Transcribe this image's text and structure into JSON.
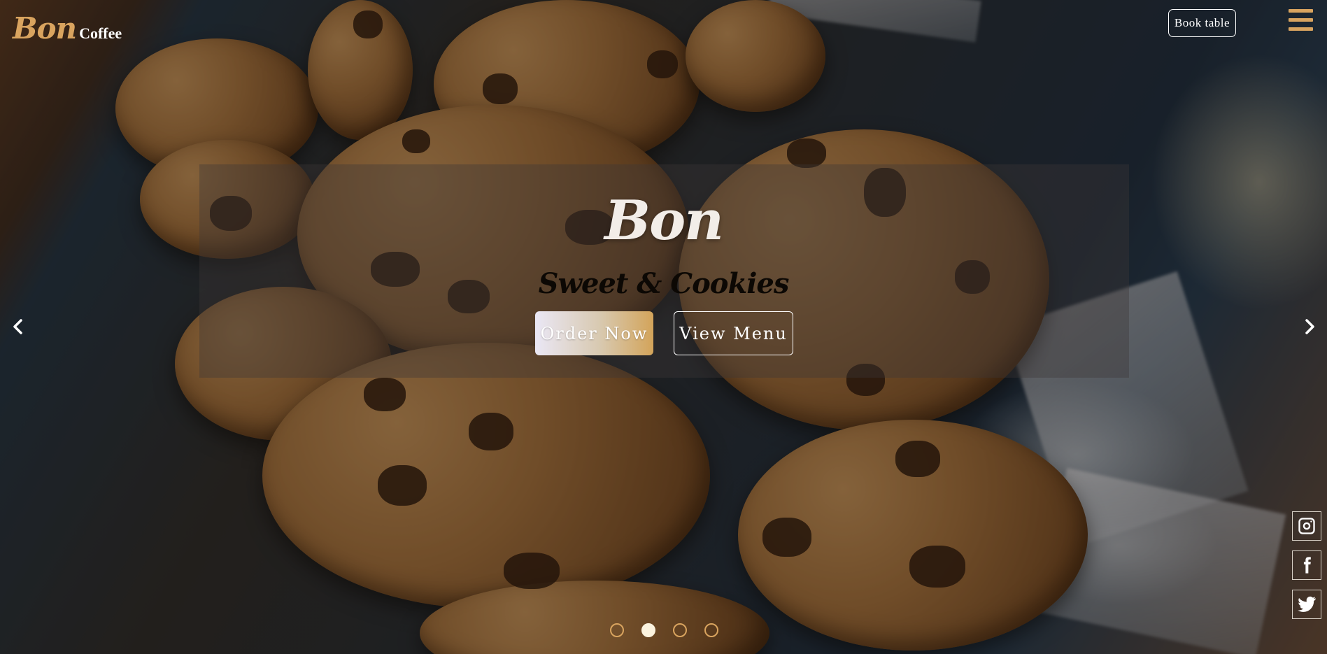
{
  "header": {
    "logo_script": "Bon",
    "logo_word": "Coffee",
    "book_label": "Book table",
    "menu_icon": "hamburger-menu-icon"
  },
  "hero": {
    "title": "Bon",
    "subtitle": "Sweet & Cookies",
    "order_label": "Order Now",
    "menu_label": "View Menu",
    "prev_icon": "chevron-left-icon",
    "next_icon": "chevron-right-icon"
  },
  "carousel": {
    "slides": 4,
    "active_index": 1
  },
  "social": [
    {
      "name": "instagram",
      "icon": "instagram-icon"
    },
    {
      "name": "facebook",
      "icon": "facebook-icon"
    },
    {
      "name": "twitter",
      "icon": "twitter-icon"
    }
  ],
  "colors": {
    "accent": "#d9a45f",
    "dot_active": "#fbf3df",
    "panel": "rgba(60,55,55,0.38)"
  }
}
